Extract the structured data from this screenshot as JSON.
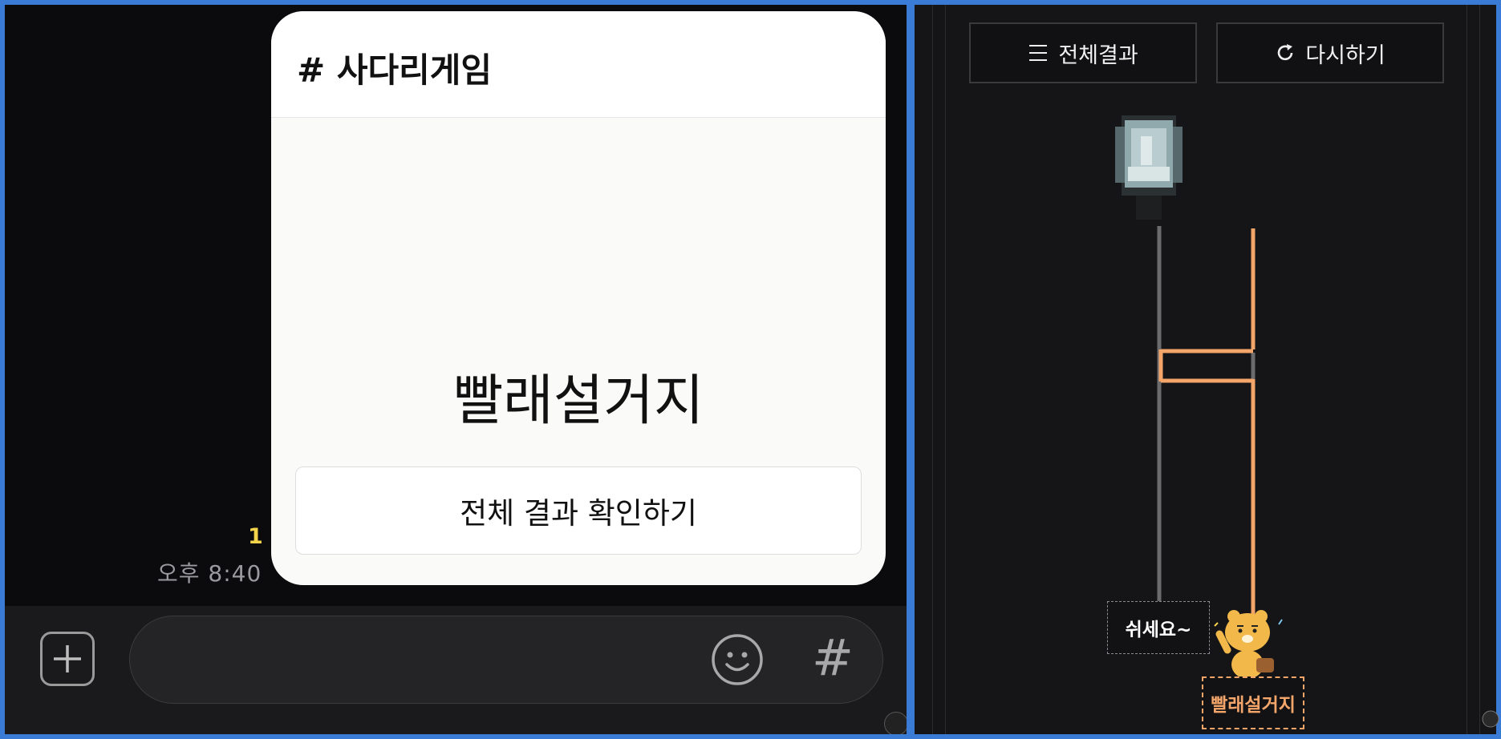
{
  "chat": {
    "unread_count": "1",
    "message_time": "오후 8:40"
  },
  "ladder_card": {
    "title": "# 사다리게임",
    "result": "빨래설거지",
    "view_all_button": "전체 결과 확인하기"
  },
  "input_bar": {
    "plus_icon": "plus-icon",
    "emoji_icon": "smiley-icon",
    "hash_symbol": "#"
  },
  "ladder_view": {
    "all_results_button": "전체결과",
    "retry_button": "다시하기",
    "outcomes": [
      {
        "label": "쉬세요~",
        "highlighted": false
      },
      {
        "label": "빨래설거지",
        "highlighted": true
      }
    ],
    "colors": {
      "path_highlight": "#f3a56a",
      "path_default": "#6b6b6e"
    }
  }
}
